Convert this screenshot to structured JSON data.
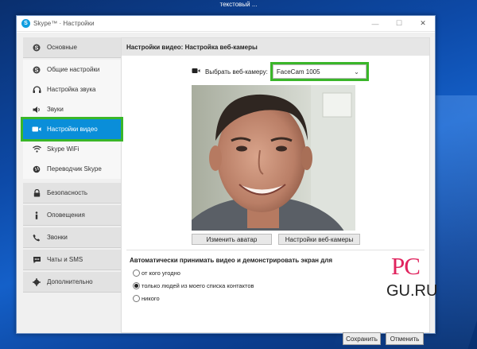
{
  "desktop": {
    "caption": "текстовый ..."
  },
  "window": {
    "title": "Skype™ · Настройки",
    "controls": {
      "minimize": "—",
      "maximize": "☐",
      "close": "✕"
    }
  },
  "sidebar": {
    "sections": [
      {
        "label": "Основные",
        "icon": "skype-icon",
        "items": [
          {
            "label": "Общие настройки",
            "icon": "skype-icon"
          },
          {
            "label": "Настройка звука",
            "icon": "headset-icon"
          },
          {
            "label": "Звуки",
            "icon": "speaker-icon"
          },
          {
            "label": "Настройки видео",
            "icon": "camera-icon",
            "active": true
          },
          {
            "label": "Skype WiFi",
            "icon": "wifi-icon"
          },
          {
            "label": "Переводчик Skype",
            "icon": "globe-icon"
          }
        ]
      },
      {
        "label": "Безопасность",
        "icon": "lock-icon"
      },
      {
        "label": "Оповещения",
        "icon": "info-icon"
      },
      {
        "label": "Звонки",
        "icon": "phone-icon"
      },
      {
        "label": "Чаты и SMS",
        "icon": "chat-icon"
      },
      {
        "label": "Дополнительно",
        "icon": "gear-icon"
      }
    ]
  },
  "panel": {
    "header": "Настройки видео: Настройка веб-камеры",
    "camera_label": "Выбрать веб-камеру:",
    "camera_selected": "FaceCam 1005",
    "change_avatar": "Изменить аватар",
    "webcam_settings": "Настройки веб-камеры",
    "auto_title": "Автоматически принимать видео и демонстрировать экран для",
    "radio_options": [
      {
        "label": "от кого угодно",
        "checked": false
      },
      {
        "label": "только людей из моего списка контактов",
        "checked": true
      },
      {
        "label": "никого",
        "checked": false
      }
    ]
  },
  "footer": {
    "save": "Сохранить",
    "cancel": "Отменить"
  },
  "watermark": {
    "top": "PC",
    "bottom": "GU.RU"
  },
  "colors": {
    "accent": "#0a8ed9",
    "highlight": "#3ab629",
    "watermark": "#e0245e"
  }
}
